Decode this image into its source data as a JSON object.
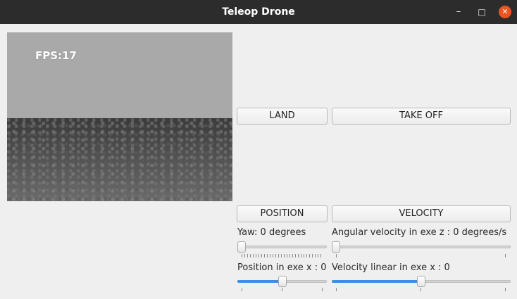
{
  "window": {
    "title": "Teleop Drone",
    "minimize_glyph": "–",
    "maximize_glyph": "□",
    "close_glyph": "✕"
  },
  "camera": {
    "fps_label": "FPS:17"
  },
  "buttons": {
    "land": "LAND",
    "take_off": "TAKE OFF",
    "position": "POSITION",
    "velocity": "VELOCITY"
  },
  "controls": {
    "yaw_label": "Yaw: 0 degrees",
    "angular_velocity_label": "Angular velocity in exe z : 0 degrees/s",
    "position_x_label": "Position in exe x : 0",
    "velocity_linear_x_label": "Velocity linear in exe x : 0"
  },
  "sliders": {
    "yaw_level": 0.0,
    "angular_velocity_level": 0.0,
    "position_x_level": 0.5,
    "velocity_linear_x_level": 0.5
  },
  "colors": {
    "titlebar": "#2c2c2c",
    "close_button": "#e95420",
    "slider_fill": "#3d8ee0",
    "background": "#efefef"
  },
  "icons": {
    "minimize": "minimize-icon",
    "maximize": "maximize-icon",
    "close": "close-icon"
  }
}
